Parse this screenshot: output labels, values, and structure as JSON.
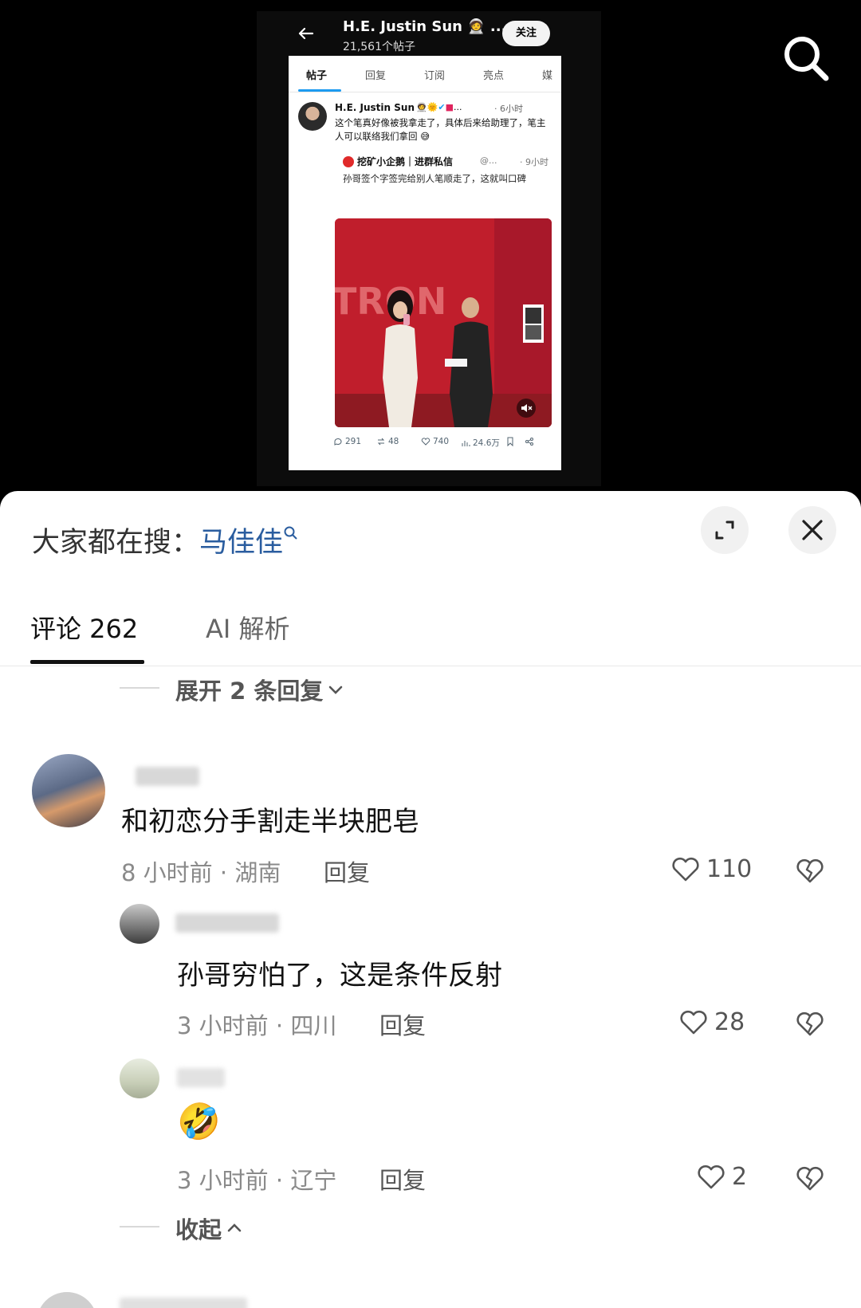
{
  "embed": {
    "profile_name": "H.E. Justin Sun 🧑‍🚀 ...",
    "post_count": "21,561个帖子",
    "follow_label": "关注",
    "tabs": [
      "帖子",
      "回复",
      "订阅",
      "亮点",
      "媒"
    ],
    "post": {
      "author": "H.E. Justin Sun",
      "time": "· 6小时",
      "text": "这个笔真好像被我拿走了，具体后来给助理了，笔主人可以联络我们拿回 😅",
      "quote": {
        "author": "挖矿小企鹅｜进群私信",
        "handle": "@...",
        "time": "· 9小时",
        "text": "孙哥签个字签完给别人笔顺走了，这就叫口碑"
      },
      "image_sign": "TRON",
      "actions": {
        "comments": "291",
        "reposts": "48",
        "likes": "740",
        "views": "24.6万"
      }
    }
  },
  "sheet": {
    "hot_search_prefix": "大家都在搜：",
    "hot_search_keyword": "马佳佳",
    "tabs": {
      "comments": "评论 262",
      "ai": "AI 解析"
    },
    "expand_replies": "展开 2 条回复",
    "collapse": "收起",
    "comments": [
      {
        "text": "和初恋分手割走半块肥皂",
        "meta": "8 小时前 · 湖南",
        "reply": "回复",
        "likes": "110"
      },
      {
        "text": "孙哥穷怕了，这是条件反射",
        "meta": "3 小时前 · 四川",
        "reply": "回复",
        "likes": "28"
      },
      {
        "text": "",
        "emoji": "🤣",
        "meta": "3 小时前 · 辽宁",
        "reply": "回复",
        "likes": "2"
      }
    ]
  }
}
